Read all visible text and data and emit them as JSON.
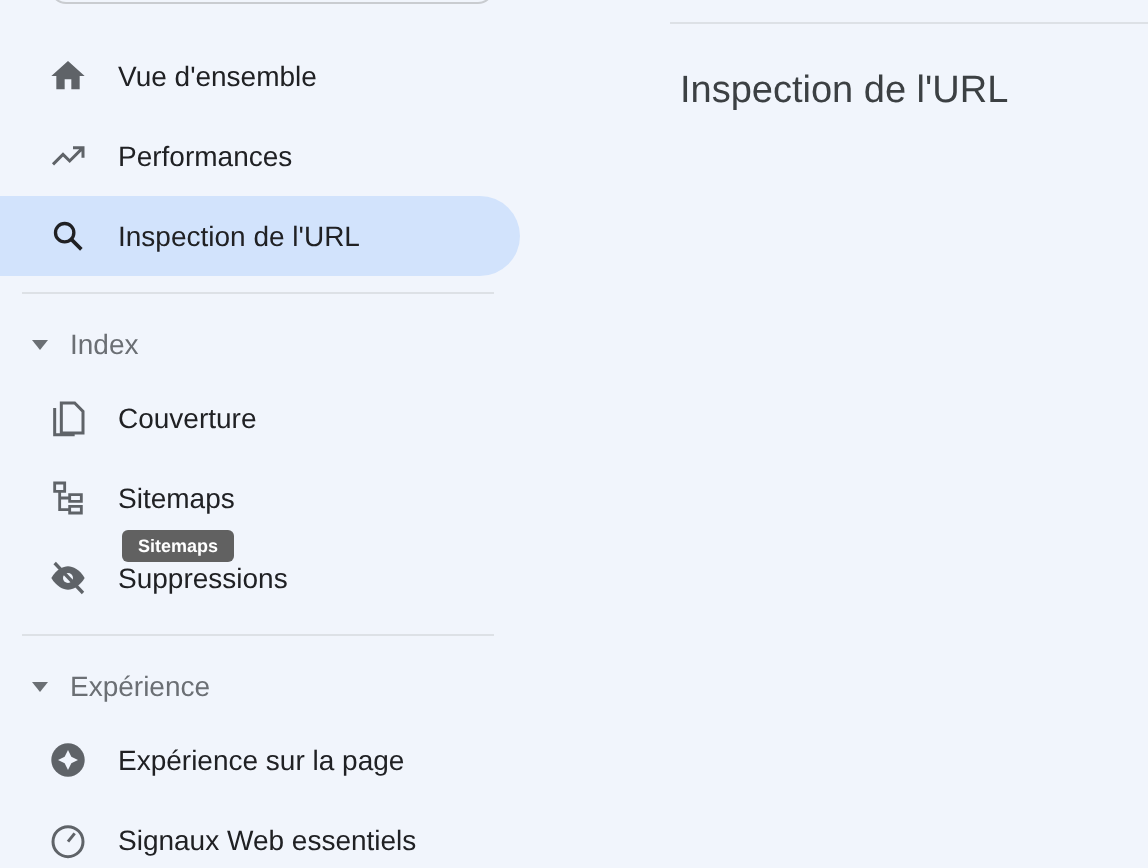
{
  "sidebar": {
    "groups": [
      {
        "items": [
          {
            "label": "Vue d'ensemble",
            "selected": false
          },
          {
            "label": "Performances",
            "selected": false
          },
          {
            "label": "Inspection de l'URL",
            "selected": true
          }
        ]
      },
      {
        "title": "Index",
        "expanded": true,
        "items": [
          {
            "label": "Couverture",
            "selected": false
          },
          {
            "label": "Sitemaps",
            "selected": false
          },
          {
            "label": "Suppressions",
            "selected": false
          }
        ]
      },
      {
        "title": "Expérience",
        "expanded": true,
        "items": [
          {
            "label": "Expérience sur la page",
            "selected": false
          },
          {
            "label": "Signaux Web essentiels",
            "selected": false
          }
        ]
      }
    ]
  },
  "tooltip": {
    "text": "Sitemaps"
  },
  "main": {
    "title": "Inspection de l'URL"
  }
}
